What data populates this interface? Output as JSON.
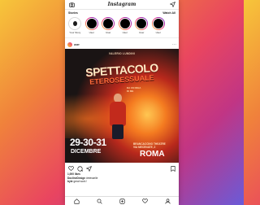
{
  "app": {
    "title": "Instagram"
  },
  "stories": {
    "header": "Stories",
    "watch_all": "Watch All",
    "items": [
      {
        "label": "Your Story"
      },
      {
        "label": "User"
      },
      {
        "label": "User"
      },
      {
        "label": "User"
      },
      {
        "label": "User"
      },
      {
        "label": "User"
      }
    ]
  },
  "post": {
    "username": "user",
    "poster": {
      "author": "VALERIO LUNDINI",
      "title_line1": "SPETTACOLO",
      "title_line2": "ETEROSESSUALE",
      "tagline_line1": "DA UN IDEA",
      "tagline_line2": "DI ME",
      "dates": "29-30-31",
      "month": "DICEMBRE",
      "venue_line1": "BRANCACCINO THEATRE",
      "venue_line2": "VIA MECENATE, 2",
      "city": "ROMA"
    },
    "likes": "1,000 likes",
    "caption_user": "DoclineDesign",
    "caption_text": "#etesselle",
    "comment_user": "byte",
    "comment_text": "great work !"
  },
  "icons": {
    "camera": "camera-icon",
    "send": "send-icon",
    "more": "more-icon",
    "heart": "heart-icon",
    "comment": "comment-icon",
    "share": "share-icon",
    "bookmark": "bookmark-icon",
    "home": "home-icon",
    "search": "search-icon",
    "add": "add-post-icon",
    "activity": "heart-icon",
    "profile": "profile-icon"
  }
}
